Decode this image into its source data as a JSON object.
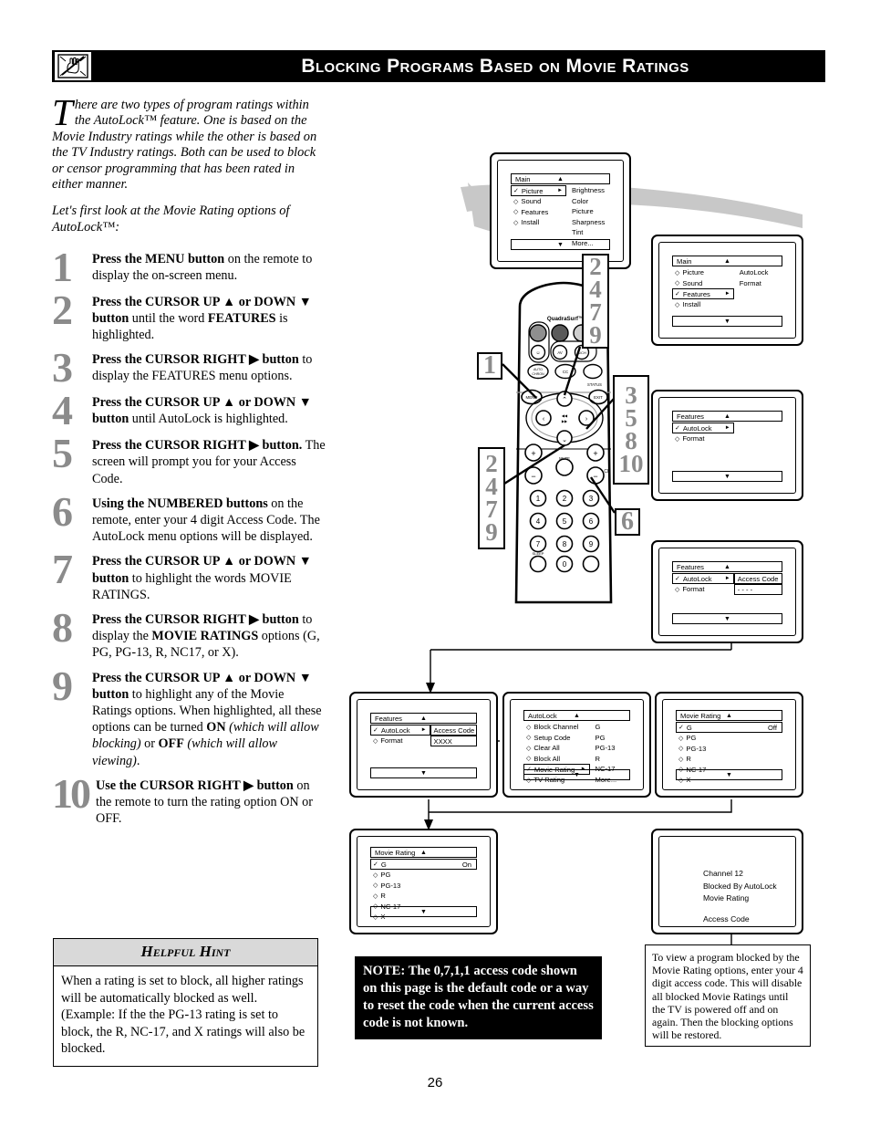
{
  "header": {
    "title": "Blocking Programs Based on Movie Ratings",
    "icon": "hand-pointing-no-icon"
  },
  "intro": {
    "dropcap": "T",
    "paragraph1": "here are two types of program ratings within the AutoLock™ feature. One is based on the Movie Industry ratings while the other is based on the TV Industry ratings. Both can be used to block or censor programming that has been rated in either manner.",
    "paragraph1_rest": "here are two types of program ratings within the AutoLock™ feature. One is",
    "paragraph1_body": "based on the Movie Industry ratings while the other is based on the TV Industry ratings. Both can be used to block or censor programming that has been rated in either manner.",
    "paragraph2": "Let's first look at the Movie Rating options of AutoLock™:"
  },
  "steps": [
    {
      "num": "1",
      "html": "<b>Press the MENU button</b> on the remote to display the on-screen menu."
    },
    {
      "num": "2",
      "html": "<b>Press the CURSOR UP ▲ or DOWN ▼ button</b> until the word <b>FEATURES</b> is highlighted."
    },
    {
      "num": "3",
      "html": "<b>Press the CURSOR RIGHT ▶ button</b> to display the FEATURES menu options."
    },
    {
      "num": "4",
      "html": "<b>Press the CURSOR UP ▲ or DOWN ▼ button</b> until AutoLock is highlighted."
    },
    {
      "num": "5",
      "html": "<b>Press the CURSOR RIGHT ▶ button.</b> The screen will prompt you for your Access Code."
    },
    {
      "num": "6",
      "html": "<b>Using the NUMBERED buttons</b> on the remote, enter your 4 digit Access Code. The AutoLock menu options will be displayed."
    },
    {
      "num": "7",
      "html": "<b>Press the CURSOR UP ▲ or DOWN ▼ button</b> to highlight the words MOVIE RATINGS."
    },
    {
      "num": "8",
      "html": "<b>Press the CURSOR RIGHT ▶ button</b> to display the <b>MOVIE RATINGS</b> options (G, PG, PG-13, R, NC17, or X)."
    },
    {
      "num": "9",
      "html": "<b>Press the CURSOR UP ▲ or DOWN ▼ button</b> to highlight any of the Movie Ratings options. When highlighted, all these options can be turned <b>ON</b> <i>(which will allow blocking)</i> or <b>OFF</b> <i>(which will allow viewing)</i>."
    },
    {
      "num": "10",
      "html": "<b>Use the CURSOR RIGHT ▶ button</b> on the remote to turn the rating option ON or OFF."
    }
  ],
  "hint": {
    "title": "Helpful Hint",
    "body": "When a rating is set to block, all higher ratings will be automatically blocked as well. (Example: If the the PG-13 rating is set to block, the R, NC-17, and X ratings will also be blocked."
  },
  "note": {
    "text": "NOTE: The 0,7,1,1 access code shown on this page is the default code or a way to reset the code when the current access code is not known."
  },
  "info": {
    "text": "To view a program blocked by the Movie Rating options, enter your 4 digit access code. This will disable all blocked Movie Ratings until the TV is powered off and on again. Then the blocking options will be restored."
  },
  "page_number": "26",
  "callouts": [
    {
      "id": "callout-1",
      "values": [
        "1"
      ]
    },
    {
      "id": "callout-2479-top",
      "values": [
        "2",
        "4",
        "7",
        "9"
      ]
    },
    {
      "id": "callout-3-5-8-10",
      "values": [
        "3",
        "5",
        "8",
        "10"
      ]
    },
    {
      "id": "callout-2479-bottom",
      "values": [
        "2",
        "4",
        "7",
        "9"
      ]
    },
    {
      "id": "callout-6",
      "values": [
        "6"
      ]
    }
  ],
  "screens": {
    "main_picture": {
      "name": "main-picture-menu",
      "title": "Main",
      "left_items": [
        {
          "label": "Picture",
          "selected": true
        },
        {
          "label": "Sound",
          "selected": false
        },
        {
          "label": "Features",
          "selected": false
        },
        {
          "label": "Install",
          "selected": false
        }
      ],
      "right_items": [
        "Brightness",
        "Color",
        "Picture",
        "Sharpness",
        "Tint",
        "More..."
      ]
    },
    "main_features": {
      "name": "main-features-menu",
      "title": "Main",
      "left_items": [
        {
          "label": "Picture",
          "selected": false
        },
        {
          "label": "Sound",
          "selected": false
        },
        {
          "label": "Features",
          "selected": true
        },
        {
          "label": "Install",
          "selected": false
        }
      ],
      "right_items": [
        "AutoLock",
        "Format"
      ]
    },
    "features_autolock": {
      "name": "features-autolock-menu",
      "title": "Features",
      "left_items": [
        {
          "label": "AutoLock",
          "selected": true
        },
        {
          "label": "Format",
          "selected": false
        }
      ],
      "right_items": []
    },
    "features_access_code": {
      "name": "features-access-code-menu",
      "title": "Features",
      "left_items": [
        {
          "label": "AutoLock",
          "selected": true
        },
        {
          "label": "Format",
          "selected": false
        }
      ],
      "right_label": "Access Code",
      "right_value": "- - - -"
    },
    "features_access_code_entered": {
      "name": "features-access-code-entered-menu",
      "title": "Features",
      "left_items": [
        {
          "label": "AutoLock",
          "selected": true
        },
        {
          "label": "Format",
          "selected": false
        }
      ],
      "right_label": "Access Code",
      "right_value": "XXXX"
    },
    "autolock_menu": {
      "name": "autolock-menu",
      "title": "AutoLock",
      "left_items": [
        {
          "label": "Block Channel",
          "selected": false
        },
        {
          "label": "Setup Code",
          "selected": false
        },
        {
          "label": "Clear All",
          "selected": false
        },
        {
          "label": "Block All",
          "selected": false
        },
        {
          "label": "Movie Rating",
          "selected": true
        },
        {
          "label": "TV Rating",
          "selected": false
        }
      ],
      "right_items": [
        "G",
        "PG",
        "PG-13",
        "R",
        "NC-17",
        "More..."
      ]
    },
    "movie_rating_off": {
      "name": "movie-rating-off-menu",
      "title": "Movie Rating",
      "value_label": "Off",
      "left_items": [
        {
          "label": "G",
          "selected": true
        },
        {
          "label": "PG",
          "selected": false
        },
        {
          "label": "PG-13",
          "selected": false
        },
        {
          "label": "R",
          "selected": false
        },
        {
          "label": "NC-17",
          "selected": false
        },
        {
          "label": "X",
          "selected": false
        }
      ]
    },
    "movie_rating_on": {
      "name": "movie-rating-on-menu",
      "title": "Movie Rating",
      "value_label": "On",
      "left_items": [
        {
          "label": "G",
          "selected": true
        },
        {
          "label": "PG",
          "selected": false
        },
        {
          "label": "PG-13",
          "selected": false
        },
        {
          "label": "R",
          "selected": false
        },
        {
          "label": "NC-17",
          "selected": false
        },
        {
          "label": "X",
          "selected": false
        }
      ]
    },
    "blocked_message": {
      "name": "blocked-channel-message",
      "line1": "Channel 12",
      "line2": "Blocked By AutoLock",
      "line3": "Movie Rating",
      "line4": "Access Code",
      "line5": "- - - -"
    }
  },
  "remote": {
    "brand": "QuadraSurf™",
    "labels": {
      "power": "POWER",
      "menu": "MENU",
      "exit": "EXIT",
      "status": "STATUS",
      "mute": "MUTE",
      "ch": "CH",
      "sleep": "SLEEP",
      "cc": "CC",
      "auto_chron": "AUTO CHRON",
      "av": "AV",
      "avon": "A/CH"
    },
    "keypad": [
      "1",
      "2",
      "3",
      "4",
      "5",
      "6",
      "7",
      "8",
      "9",
      "0"
    ]
  }
}
